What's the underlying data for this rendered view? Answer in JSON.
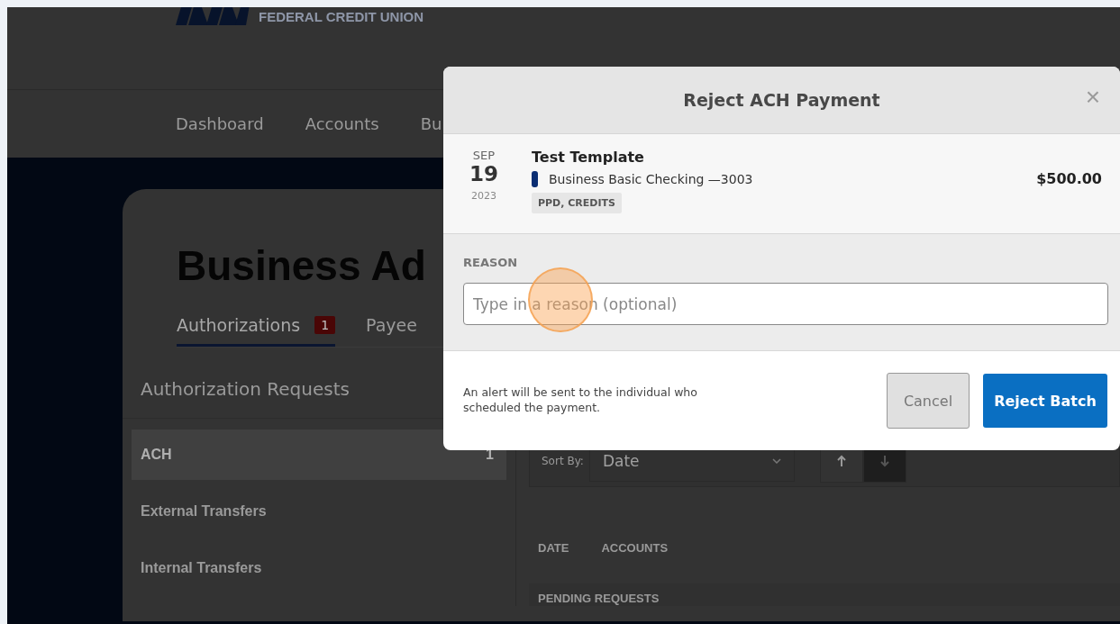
{
  "header": {
    "logo_text": "FEDERAL CREDIT UNION"
  },
  "nav": [
    {
      "label": "Dashboard"
    },
    {
      "label": "Accounts"
    },
    {
      "label": "Bu"
    }
  ],
  "page": {
    "title": "Business Ad",
    "tabs": [
      {
        "label": "Authorizations",
        "badge": "1",
        "selected": true
      },
      {
        "label": "Payee",
        "selected": false
      }
    ],
    "requests_heading": "Authorization Requests",
    "request_types": [
      {
        "label": "ACH",
        "count": "1",
        "selected": true
      },
      {
        "label": "External Transfers",
        "selected": false
      },
      {
        "label": "Internal Transfers",
        "selected": false
      }
    ],
    "sort": {
      "label": "Sort By:",
      "value": "Date",
      "directions": [
        {
          "kind": "up",
          "selected": false
        },
        {
          "kind": "down",
          "selected": true
        }
      ]
    },
    "columns": [
      "DATE",
      "ACCOUNTS"
    ],
    "section": "PENDING REQUESTS"
  },
  "modal": {
    "title": "Reject ACH Payment",
    "close": "×",
    "payment": {
      "month": "SEP",
      "day": "19",
      "year": "2023",
      "name": "Test Template",
      "account": {
        "name": "Business Basic Checking —3003",
        "color": "#0b2e73"
      },
      "tag": "PPD, CREDITS",
      "amount": "$500.00"
    },
    "reason": {
      "label": "REASON",
      "placeholder": "Type in a reason (optional)"
    },
    "note": "An alert will be sent to the individual who scheduled the payment.",
    "buttons": [
      {
        "label": "Cancel",
        "kind": "secondary"
      },
      {
        "label": "Reject Batch",
        "kind": "primary"
      }
    ]
  }
}
